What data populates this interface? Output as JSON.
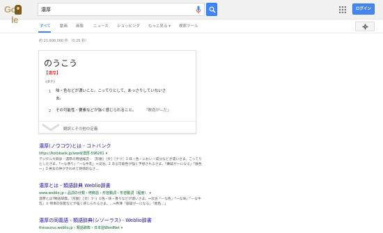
{
  "header": {
    "logo_alt": "Google",
    "search_value": "濃厚",
    "login_label": "ログイン"
  },
  "tabs": [
    {
      "label": "すべて"
    },
    {
      "label": "動画"
    },
    {
      "label": "画像"
    },
    {
      "label": "ニュース"
    },
    {
      "label": "ショッピング"
    },
    {
      "label": "もっと見る ▾"
    },
    {
      "label": "検索ツール"
    }
  ],
  "result_stats": "約 21,600,000 件 （0.25 秒）",
  "dictionary": {
    "word": "のうこう",
    "kanji": "濃厚",
    "pos": "《ダナ》",
    "definitions": [
      {
        "num": "1",
        "line1": "味・色などが濃いこと。こってりとして、あっさりしていないさ",
        "line2": "ま。"
      },
      {
        "num": "2",
        "line1": "その可能性・要素などが強く感じられること。",
        "example": "「敗色が―だ」"
      }
    ],
    "more_label": "観訳とその他の定義"
  },
  "results": [
    {
      "title": "濃厚(ノウコウ)とは - コトバンク",
      "url": "https://kotobank.jp/word/濃厚-596261",
      "snippet": "デジタル大辞泉 - 濃厚の用語解説 - ［形動］［文］［ナリ］1 味・色・におい・成分などが濃いさま。こってりとしたさま。「一な香り」「一な牛乳」⇔淡泊。2 ある可能性が強く予想されるさま。「嫌疑が一になる」「敗色―」3 男女の仲がきわめて熱情的なさ..."
    },
    {
      "title": "濃厚とは - 類語辞典 Weblio辞書",
      "url": "www.weblio.jp › 品詞の分類 › 修飾語 › 形容動詞 › 形容動詞（程度）",
      "snippet": "濃厚とは?類語辞典。［形動］［文］ナリ ①色・味・香りなどが濃いさま。⇔淡泊「一な色」「一な味」「一な牛乳」② 物事の気配などが強く感じられるさま。…⇔希薄「容疑が一になる」「敗色…」"
    },
    {
      "title": "濃厚の同義語 - 類語辞典(シソーラス) - Weblio辞書",
      "url": "thesaurus.weblio.jp › 類語辞典 › 日本語WordNet",
      "snippet": ""
    }
  ],
  "colors": {
    "link": "#1a0dab",
    "url": "#006621",
    "accent": "#4285f4"
  }
}
